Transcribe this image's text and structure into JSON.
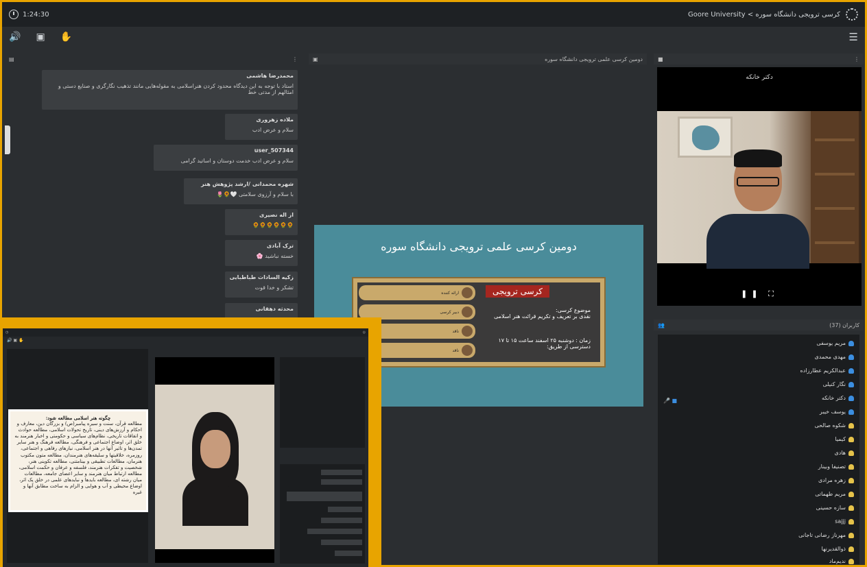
{
  "topbar": {
    "timer": "1:24:30",
    "title": "Goore University < کرسی ترویجی دانشگاه سوره"
  },
  "chat": {
    "messages": [
      {
        "who": "محمدرضا هاشمی",
        "text": "استاد با توجه به این دیدگاه محدود کردن هنراسلامی به مقوله‌هایی مانند تذهیب نگارگری و صنایع دستی و امثالهم از مدتی خط"
      },
      {
        "who": "ملاده زهروری",
        "text": "سلام و عرض ادب"
      },
      {
        "who": "user_507344",
        "text": "سلام و عرض ادب خدمت دوستان و اساتید گرامی"
      },
      {
        "who": "شهره محمدانی /ارشد پژوهش هنر",
        "text": "با سلام و آرزوی سلامتی 🤍🌻🌷"
      },
      {
        "who": "از اله نصیری",
        "text": "🌻🌻🌻🌻🌻🌻"
      },
      {
        "who": "ترک آبادی",
        "text": "خسته نباشید 🌸"
      },
      {
        "who": "زکیه السادات طباطبایی",
        "text": "تشکر و خدا قوت"
      },
      {
        "who": "محدثه دهقانی",
        "text": ""
      }
    ]
  },
  "slide": {
    "header": "دومین کرسی علمی ترویجی دانشگاه سوره",
    "title": "دومین کرسی علمی ترویجی دانشگاه سوره",
    "banner_label": "کرسی ترویجی",
    "topic_label": "موضوع کرسی:",
    "topic": "نقدی بر تعریف و تکریم قرائت هنر اسلامی",
    "date": "زمان : دوشنبه ۲۵ اسفند ساعت ۱۵ تا ۱۷",
    "access": "دسترسی از طریق:",
    "speakers": [
      "ارائه کننده",
      "دبیر کرسی",
      "ناقد",
      "ناقد"
    ]
  },
  "camera": {
    "name": "دکتر خانکه",
    "controls": "❚❚ ⛶"
  },
  "users": {
    "header": "کاربران (37)",
    "list": [
      {
        "name": "مریم یوسفی",
        "color": "#3b8ee0"
      },
      {
        "name": "مهدی محمدی",
        "color": "#3b8ee0"
      },
      {
        "name": "عبدالکریم عطارزاده",
        "color": "#3b8ee0"
      },
      {
        "name": "نگار کنیلی",
        "color": "#3b8ee0"
      },
      {
        "name": "دکتر خانکه",
        "color": "#3b8ee0"
      },
      {
        "name": "یوسف خیبر",
        "color": "#3b8ee0"
      },
      {
        "name": "شکوه صالحی",
        "color": "#e6c34a"
      },
      {
        "name": "کیمیا",
        "color": "#e6c34a"
      },
      {
        "name": "هادی",
        "color": "#e6c34a"
      },
      {
        "name": "تصنیفا وبینار",
        "color": "#e6c34a"
      },
      {
        "name": "زهره مرادی",
        "color": "#e6c34a"
      },
      {
        "name": "مریم طهماتی",
        "color": "#e6c34a"
      },
      {
        "name": "سازه حسینی",
        "color": "#e6c34a"
      },
      {
        "name": "sajjj",
        "color": "#e6c34a"
      },
      {
        "name": "مهرناز رضانی تاجانی",
        "color": "#e6c34a"
      },
      {
        "name": "ذوالقدیرنها",
        "color": "#e6c34a"
      },
      {
        "name": "ندیم‌ماد",
        "color": "#e6c34a"
      }
    ]
  },
  "inset": {
    "doc_title": "چگونه هنر اسلامی مطالعه شود:",
    "doc_text": "مطالعه قرآن، سنت و سیره پیامبر(ص) و بزرگان دین، معارف و احکام و آرزش‌های دینی، تاریخ تحولات اسلامی، مطالعه حوادث و اتفاقات تاریخی، نظام‌های سیاسی و حکومتی و اخبار هنرمند به خلق اثر، اوضاع اجتماعی و فرهنگی، مطالعه فرهنگ و هنر سایر تمدن‌ها و تاثیر آنها در هنر اسلامی، نیازهای رفاهی و اجتماعی، روزمره، خلاقیتها و سلیقه‌های هنرمندان، مطالعه متون مکتوب هنرمان، مطالعات تطبیقی و بینامتنی، مطالعه تکوینی هنر، شخصیت و تفکرات هنرمند، فلسفه و عرفان و حکمت اسلامی، مطالعه ارتباط میان هنرمند و سایر اعضای جامعه، مطالعات میان رشته ای، مطالعه بایدها و نبایدهای علمی در خلق یک اثر، اوضاع محیطی و آب و هوایی و الزام به ساخت مطابق آنها و غیره"
  }
}
